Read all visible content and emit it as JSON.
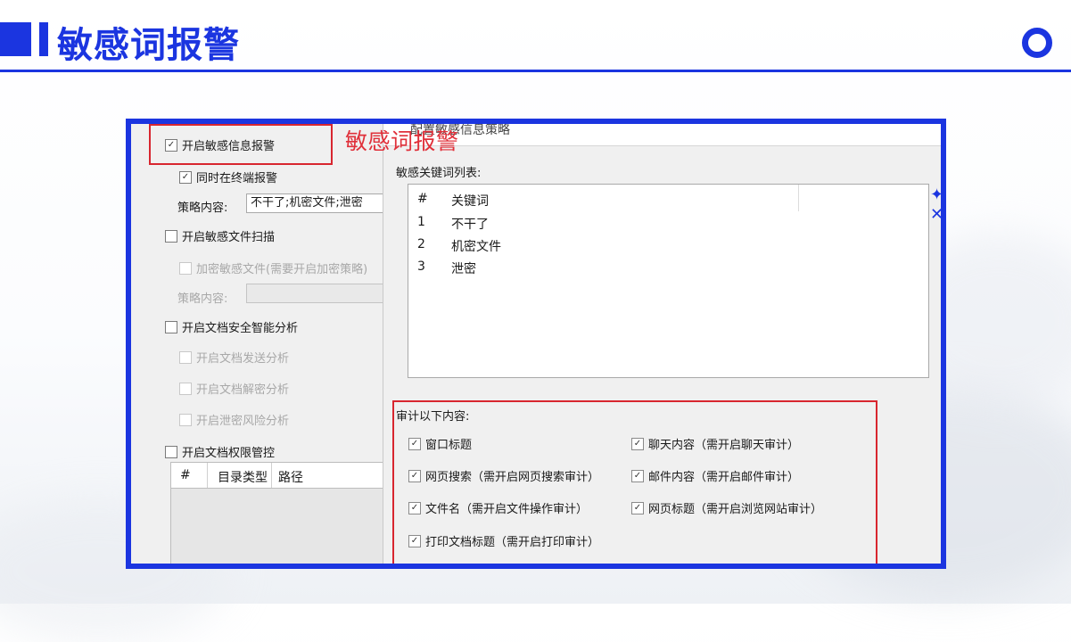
{
  "header": {
    "title": "敏感词报警"
  },
  "left_panel": {
    "enable_sensitive_alarm": {
      "label": "开启敏感信息报警",
      "checked": true
    },
    "terminal_alarm": {
      "label": "同时在终端报警",
      "checked": true
    },
    "policy_label_1": "策略内容:",
    "policy_value_1": "不干了;机密文件;泄密",
    "enable_file_scan": {
      "label": "开启敏感文件扫描",
      "checked": false
    },
    "encrypt_sensitive": {
      "label": "加密敏感文件(需要开启加密策略)",
      "checked": false
    },
    "policy_label_2": "策略内容:",
    "policy_value_2": "",
    "smart_analysis": {
      "label": "开启文档安全智能分析",
      "checked": false
    },
    "send_analysis": {
      "label": "开启文档发送分析",
      "checked": false
    },
    "decrypt_analysis": {
      "label": "开启文档解密分析",
      "checked": false
    },
    "leak_analysis": {
      "label": "开启泄密风险分析",
      "checked": false
    },
    "permission_control": {
      "label": "开启文档权限管控",
      "checked": false
    },
    "table_headers": [
      "#",
      "目录类型",
      "路径"
    ]
  },
  "right_panel": {
    "dialog_title": "配置敏感信息策略",
    "keyword_list_label": "敏感关键词列表:",
    "keyword_headers": [
      "#",
      "关键词"
    ],
    "keywords": [
      {
        "index": "1",
        "word": "不干了"
      },
      {
        "index": "2",
        "word": "机密文件"
      },
      {
        "index": "3",
        "word": "泄密"
      }
    ],
    "audit_label": "审计以下内容:",
    "audit_items": [
      {
        "label": "窗口标题",
        "checked": true
      },
      {
        "label": "聊天内容（需开启聊天审计）",
        "checked": true
      },
      {
        "label": "网页搜索（需开启网页搜索审计）",
        "checked": true
      },
      {
        "label": "邮件内容（需开启邮件审计）",
        "checked": true
      },
      {
        "label": "文件名（需开启文件操作审计）",
        "checked": true
      },
      {
        "label": "网页标题（需开启浏览网站审计）",
        "checked": true
      },
      {
        "label": "打印文档标题（需开启打印审计）",
        "checked": true
      }
    ]
  },
  "overlay_caption": "敏感词报警",
  "colors": {
    "accent": "#1b35e0",
    "highlight": "#d8262f"
  }
}
